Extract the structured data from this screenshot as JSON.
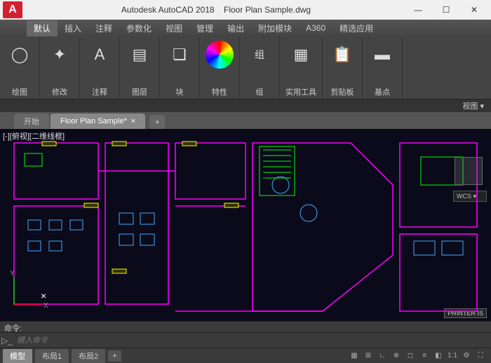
{
  "title": {
    "app": "Autodesk AutoCAD 2018",
    "file": "Floor Plan Sample.dwg"
  },
  "logo": "A",
  "win": {
    "min": "—",
    "max": "☐",
    "close": "✕"
  },
  "menu": [
    "默认",
    "插入",
    "注释",
    "参数化",
    "视图",
    "管理",
    "输出",
    "附加模块",
    "A360",
    "精选应用"
  ],
  "ribbon": [
    {
      "label": "绘图",
      "icon": "◯"
    },
    {
      "label": "修改",
      "icon": "✦"
    },
    {
      "label": "注释",
      "icon": "A"
    },
    {
      "label": "图层",
      "icon": "▤"
    },
    {
      "label": "块",
      "icon": "❏"
    },
    {
      "label": "特性",
      "icon": "◉"
    },
    {
      "label": "组",
      "icon": "组"
    },
    {
      "label": "实用工具",
      "icon": "▦"
    },
    {
      "label": "剪贴板",
      "icon": "📋"
    },
    {
      "label": "基点",
      "icon": "▬"
    }
  ],
  "ribbon_footer": "视图 ▾",
  "doctabs": {
    "start": "开始",
    "active": "Floor Plan Sample*",
    "add": "+"
  },
  "viewport": {
    "label": "[-][俯视][二维线框]",
    "wcs": "WCS ▾",
    "printer": "PRINTER IS",
    "axis_y": "Y",
    "axis_x": "X"
  },
  "cmd": {
    "log": "命令:",
    "prefix": "▷_",
    "placeholder": "键入命令"
  },
  "status": {
    "tabs": [
      "模型",
      "布局1",
      "布局2"
    ],
    "add": "+",
    "scale": "1:1"
  }
}
